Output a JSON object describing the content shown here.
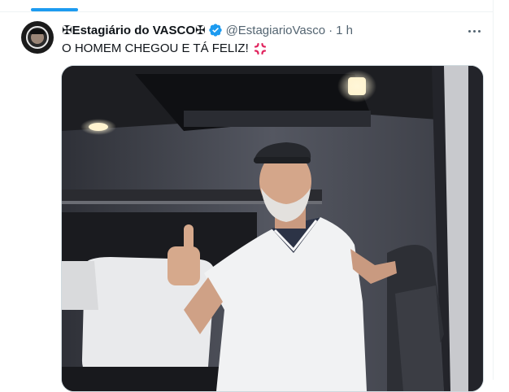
{
  "tweet": {
    "display_name": "✠Estagiário do VASCO✠",
    "handle": "@EstagiarioVasco",
    "separator": "·",
    "timestamp": "1 h",
    "text": "O HOMEM CHEGOU E TÁ FELIZ!",
    "emoji_icon": "anger-symbol-icon",
    "verified_icon": "verified-badge-icon",
    "media_description_icon": "photo"
  },
  "colors": {
    "accent": "#1d9bf0",
    "text_primary": "#0f1419",
    "text_secondary": "#536471"
  }
}
